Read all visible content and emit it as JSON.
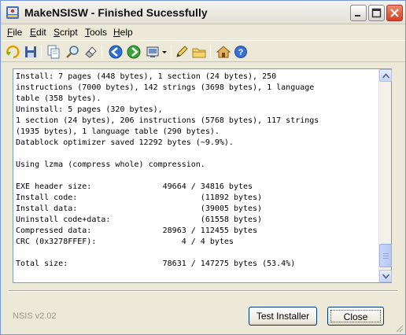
{
  "window": {
    "title": "MakeNSISW - Finished Sucessfully"
  },
  "menu": [
    {
      "label": "File",
      "accel": "F",
      "rest": "ile"
    },
    {
      "label": "Edit",
      "accel": "E",
      "rest": "dit"
    },
    {
      "label": "Script",
      "accel": "S",
      "rest": "cript"
    },
    {
      "label": "Tools",
      "accel": "T",
      "rest": "ools"
    },
    {
      "label": "Help",
      "accel": "H",
      "rest": "elp"
    }
  ],
  "toolbar": {
    "icons": [
      "recompile-icon",
      "save-icon",
      "copy-icon",
      "find-icon",
      "clear-icon",
      "back-icon",
      "test-icon",
      "compressor-icon",
      "dropdown-arrow-icon",
      "edit-script-icon",
      "browse-script-icon",
      "nsis-home-icon",
      "help-icon"
    ]
  },
  "log": {
    "lines": [
      "Install: 7 pages (448 bytes), 1 section (24 bytes), 250",
      "instructions (7000 bytes), 142 strings (3698 bytes), 1 language",
      "table (358 bytes).",
      "Uninstall: 5 pages (320 bytes),",
      "1 section (24 bytes), 206 instructions (5768 bytes), 117 strings",
      "(1935 bytes), 1 language table (290 bytes).",
      "Datablock optimizer saved 12292 bytes (~9.9%).",
      "",
      "Using lzma (compress whole) compression.",
      "",
      "EXE header size:               49664 / 34816 bytes",
      "Install code:                          (11892 bytes)",
      "Install data:                          (39005 bytes)",
      "Uninstall code+data:                   (61558 bytes)",
      "Compressed data:               28963 / 112455 bytes",
      "CRC (0x3278FFEF):                  4 / 4 bytes",
      "",
      "Total size:                    78631 / 147275 bytes (53.4%)"
    ]
  },
  "footer": {
    "version": "NSIS v2.02",
    "test_button": "Test Installer",
    "close_button": "Close"
  },
  "colors": {
    "window_bg": "#ece9d8",
    "log_border": "#7f9db9",
    "button_border": "#003c74",
    "close_button_red": "#e0442c"
  }
}
